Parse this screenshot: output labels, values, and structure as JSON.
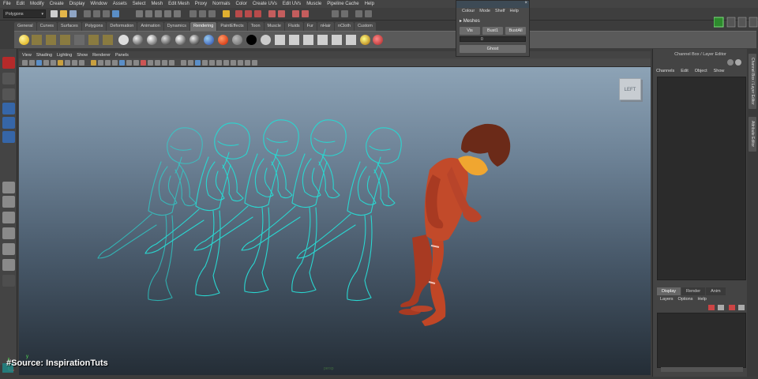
{
  "menubar": [
    "File",
    "Edit",
    "Modify",
    "Create",
    "Display",
    "Window",
    "Assets",
    "Select",
    "Mesh",
    "Edit Mesh",
    "Proxy",
    "Normals",
    "Color",
    "Create UVs",
    "Edit UVs",
    "Muscle",
    "Pipeline Cache",
    "Help"
  ],
  "status": {
    "mode": "Polygons"
  },
  "shelf": {
    "tabs": [
      "General",
      "Curves",
      "Surfaces",
      "Polygons",
      "Deformation",
      "Animation",
      "Dynamics",
      "Rendering",
      "PaintEffects",
      "Toon",
      "Muscle",
      "Fluids",
      "Fur",
      "nHair",
      "nCloth",
      "Custom"
    ],
    "active": "Rendering"
  },
  "viewport": {
    "menu": [
      "View",
      "Shading",
      "Lighting",
      "Show",
      "Renderer",
      "Panels"
    ],
    "viewcube_label": "LEFT",
    "camera_label": "persp"
  },
  "mesh_panel": {
    "menu": [
      "Colour",
      "Mode",
      "Shelf",
      "Help"
    ],
    "heading": "Meshes",
    "buttons": [
      "Vis",
      "Bust1",
      "BustAll"
    ],
    "slider_value": "0",
    "ghost_button": "Ghost",
    "close_glyph": "×"
  },
  "right_panel": {
    "title": "Channel Box / Layer Editor",
    "menu": [
      "Channels",
      "Edit",
      "Object",
      "Show"
    ],
    "layer_tabs": [
      "Display",
      "Render",
      "Anim"
    ],
    "layer_menu": [
      "Layers",
      "Options",
      "Help"
    ],
    "side_tabs": [
      "Channel Box / Layer Editor",
      "Attribute Editor"
    ]
  },
  "overlay": {
    "source": "#Source: InspirationTuts",
    "axis_y": "y"
  },
  "colors": {
    "ghost": "#2ad6d0",
    "character_body": "#c24a2a",
    "character_hair": "#6b2a18",
    "character_skin": "#f0a630",
    "active_tab": "#6f6f6f",
    "select_tool": "#d03030"
  }
}
